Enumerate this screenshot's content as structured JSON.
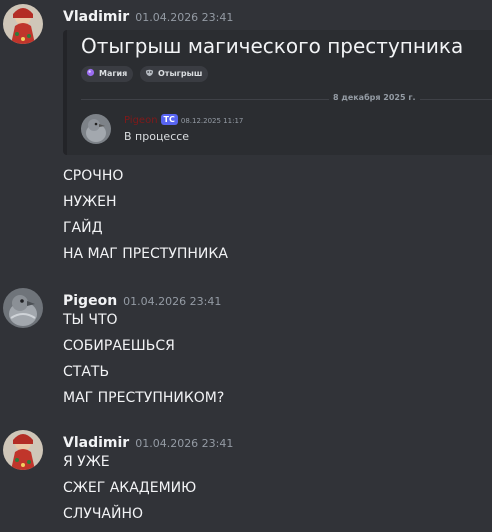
{
  "messages": [
    {
      "author": "Vladimir",
      "timestamp": "01.04.2026 23:41",
      "lines": [
        "СРОЧНО",
        "НУЖЕН",
        "ГАЙД",
        "НА МАГ ПРЕСТУПНИКА"
      ]
    },
    {
      "author": "Pigeon",
      "timestamp": "01.04.2026 23:41",
      "lines": [
        "ТЫ ЧТО",
        "СОБИРАЕШЬСЯ",
        "СТАТЬ",
        "МАГ ПРЕСТУПНИКОМ?"
      ]
    },
    {
      "author": "Vladimir",
      "timestamp": "01.04.2026 23:41",
      "lines": [
        "Я УЖЕ",
        "СЖЕГ АКАДЕМИЮ",
        "СЛУЧАЙНО"
      ]
    }
  ],
  "thread_embed": {
    "title": "Отыгрыш магического преступника",
    "tags": [
      {
        "icon": "magic-orb-icon",
        "label": "Магия"
      },
      {
        "icon": "mask-icon",
        "label": "Отыгрыш"
      }
    ],
    "divider_date": "8 декабря 2025 г.",
    "reply": {
      "author": "Pigeon",
      "badge": "ТС",
      "timestamp": "08.12.2025 11:17",
      "text": "В процессе"
    }
  },
  "colors": {
    "background": "#313338",
    "embed_background": "#2b2d31",
    "badge": "#5865f2",
    "reply_author": "#7f1a1a"
  }
}
